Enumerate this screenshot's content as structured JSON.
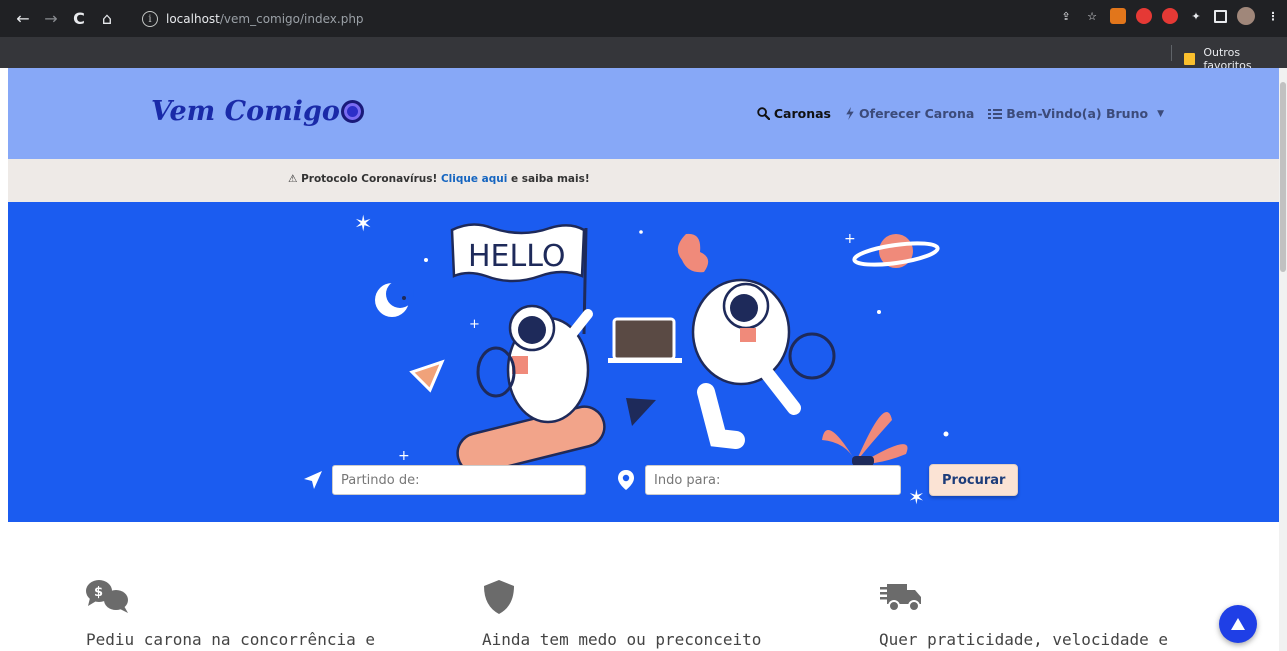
{
  "browser": {
    "url_host": "localhost",
    "url_path": "/vem_comigo/index.php",
    "bookmark_folder": "Outros favoritos"
  },
  "header": {
    "logo_text": "Vem Comigo",
    "nav": [
      {
        "label": "Caronas",
        "icon": "search-icon"
      },
      {
        "label": "Oferecer Carona",
        "icon": "bolt-icon"
      },
      {
        "label": "Bem-Vindo(a) Bruno",
        "icon": "list-icon"
      }
    ]
  },
  "notice": {
    "prefix": "Protocolo Coronavírus!",
    "link": "Clique aqui",
    "suffix": "e saiba mais!"
  },
  "hero": {
    "banner_text": "HELLO",
    "from_placeholder": "Partindo de:",
    "to_placeholder": "Indo para:",
    "search_label": "Procurar"
  },
  "features": [
    {
      "icon": "money-chat-icon",
      "text": "Pediu carona na concorrência e"
    },
    {
      "icon": "shield-icon",
      "text": "Ainda tem medo ou preconceito"
    },
    {
      "icon": "truck-icon",
      "text": "Quer praticidade, velocidade e"
    }
  ],
  "colors": {
    "header_bg": "#87a8f7",
    "hero_bg": "#1b5cf0",
    "logo": "#1a2aa8",
    "notice_bg": "#eeeae7"
  }
}
